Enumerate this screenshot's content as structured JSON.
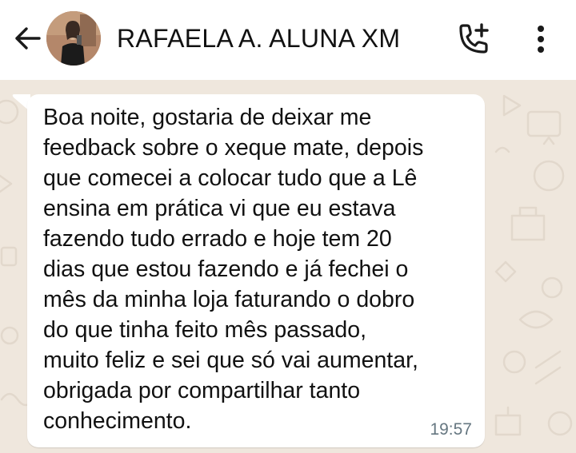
{
  "header": {
    "contact_name": "RAFAELA A. ALUNA XM",
    "icons": {
      "back": "arrow-left-icon",
      "call": "add-call-icon",
      "menu": "more-vertical-icon"
    }
  },
  "message": {
    "text": "Boa noite, gostaria de deixar me\nfeedback sobre o xeque mate, depois\nque comecei a colocar tudo que a Lê\nensina em prática vi que eu estava\nfazendo tudo errado e hoje tem 20\ndias que estou fazendo e já fechei o\nmês da minha loja faturando o dobro\ndo que tinha feito mês passado,\nmuito feliz e sei que só vai aumentar,\nobrigada por compartilhar tanto\nconhecimento.",
    "time": "19:57"
  },
  "colors": {
    "chat_background": "#efe7dd",
    "bubble": "#ffffff",
    "time": "#667781"
  }
}
